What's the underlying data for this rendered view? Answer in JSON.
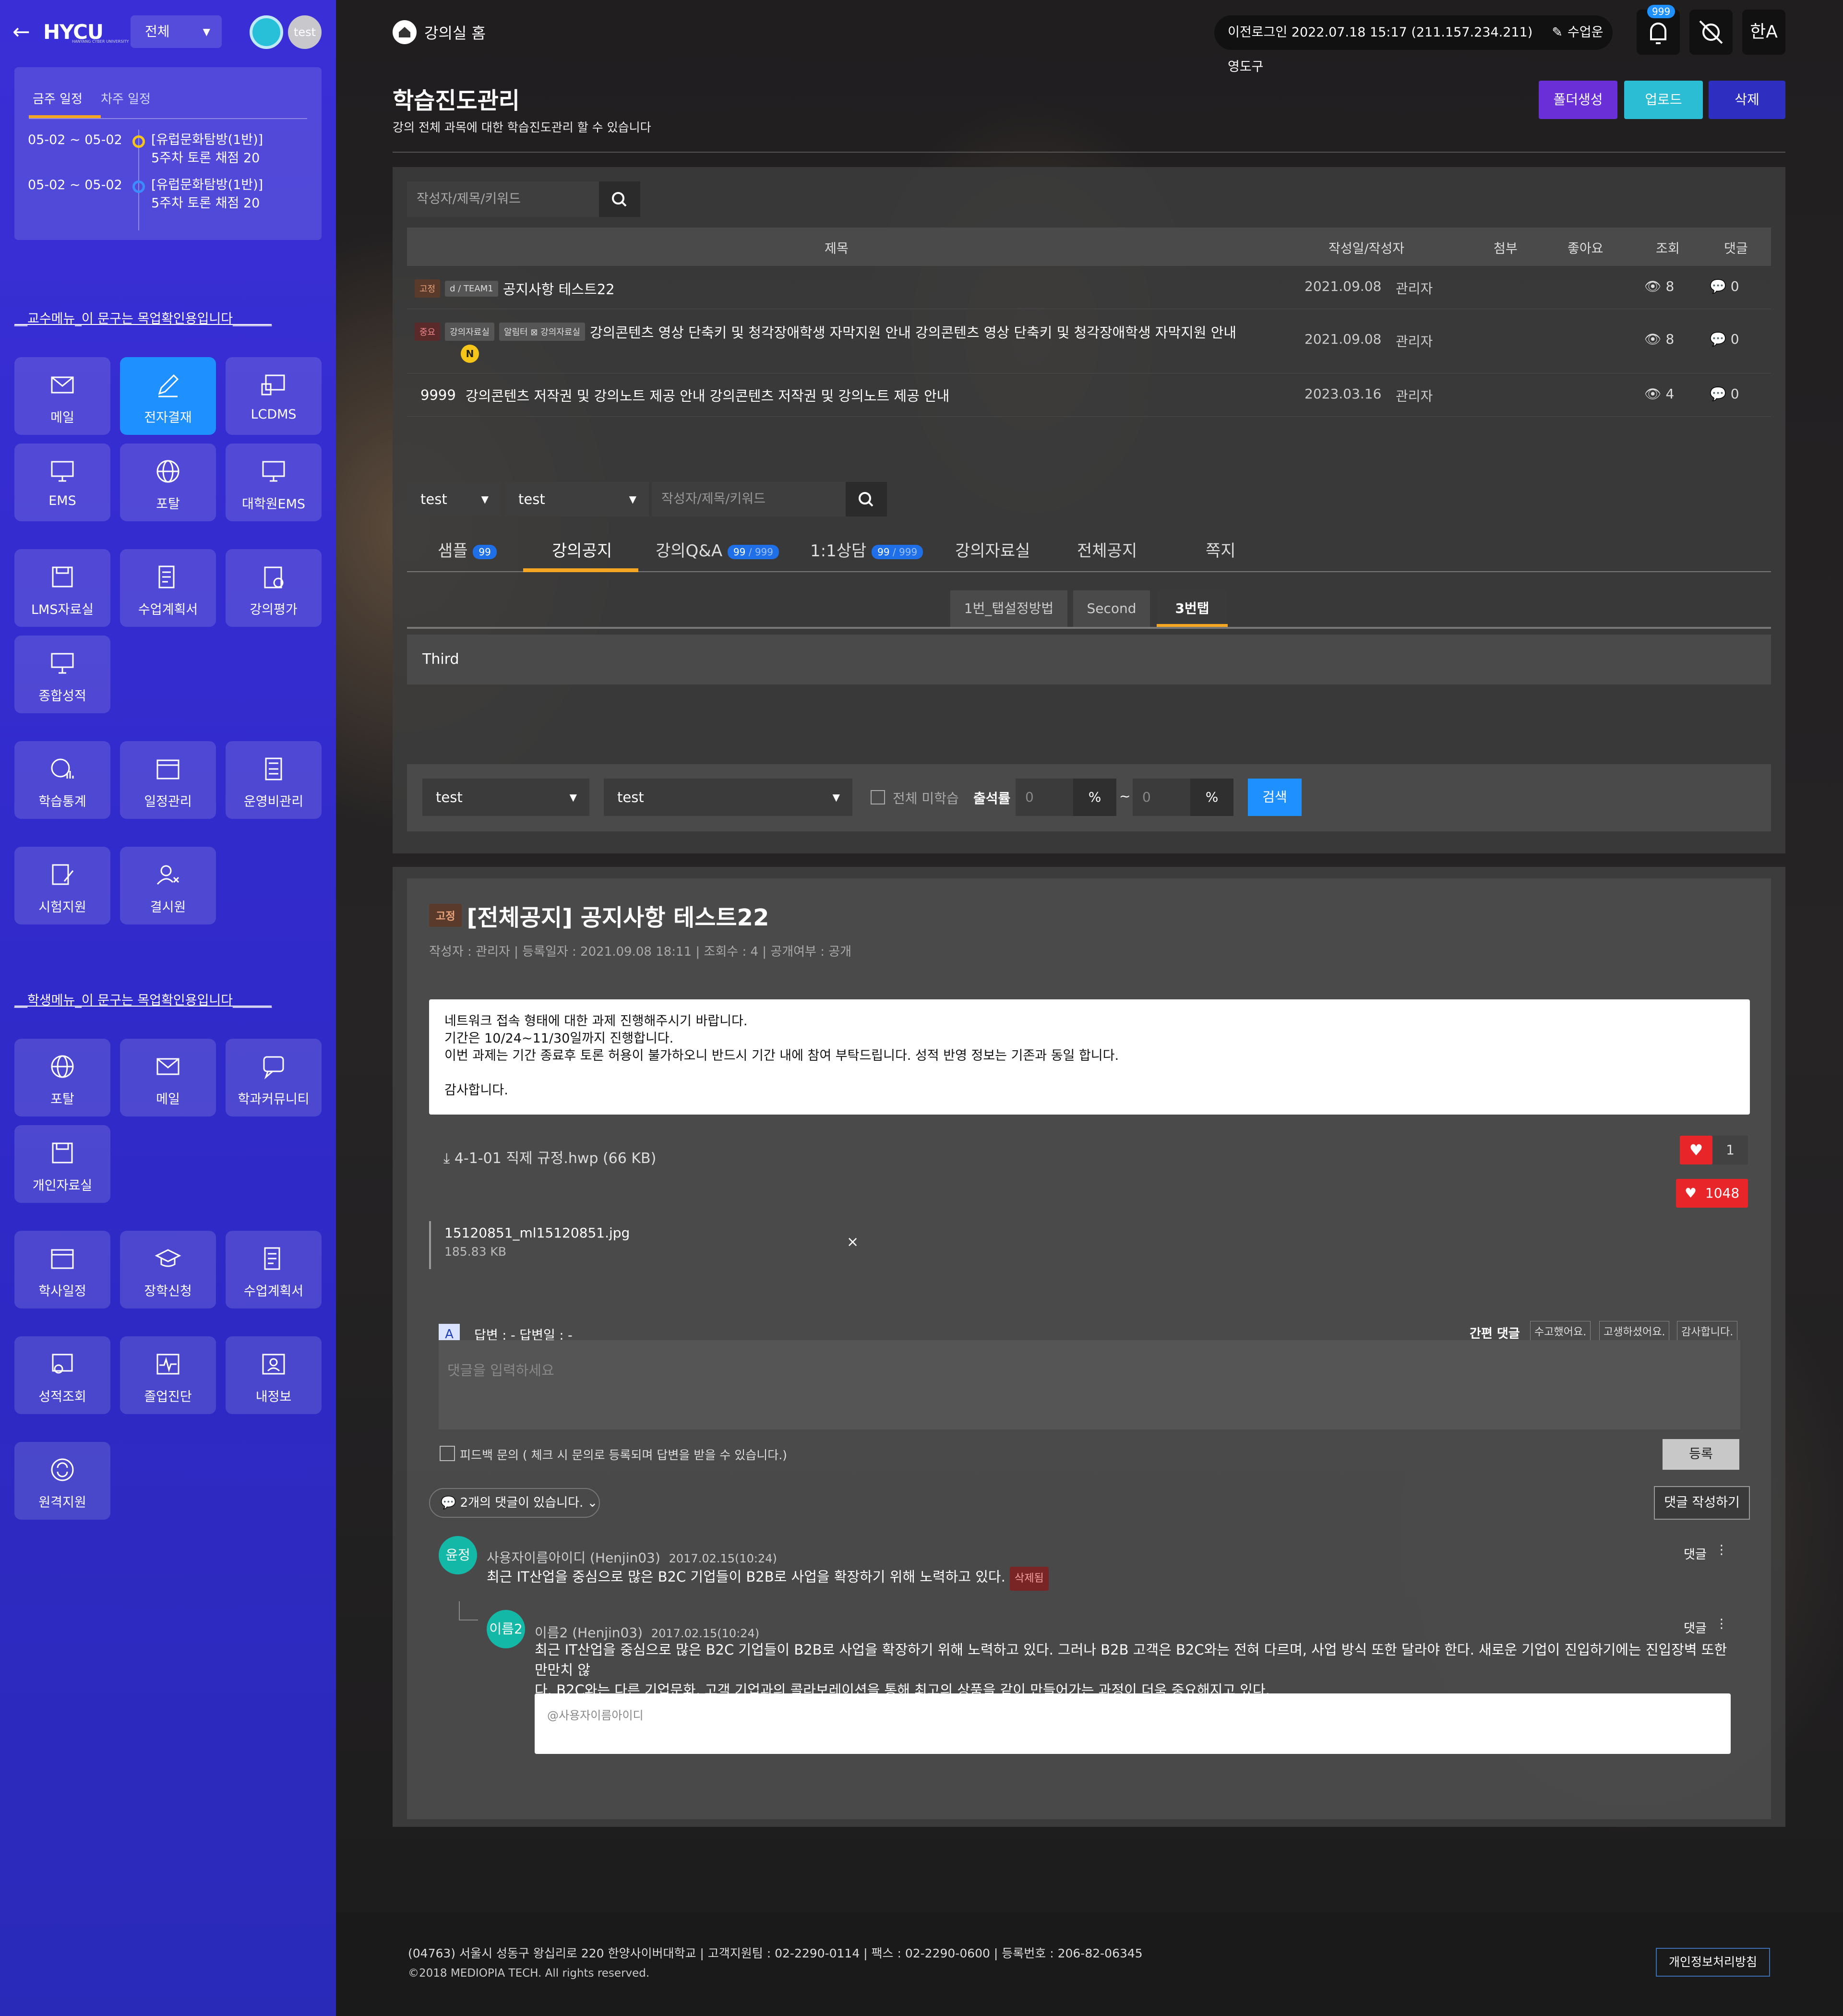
{
  "colors": {
    "sidebar": "#3a2fd6",
    "accent_orange": "#f5a623",
    "blue": "#1e90ff",
    "purple": "#6a2fd6",
    "teal": "#2bbdd4",
    "navy": "#2e2ec0"
  },
  "sidebar": {
    "logo": "HYCU",
    "logo_sub": "HANYANG CYBER UNIVERSITY",
    "scope_select": "전체",
    "avatar_text": "test",
    "schedule": {
      "tabs": [
        "금주 일정",
        "차주 일정"
      ],
      "items": [
        {
          "date": "05-02 ~ 05-02",
          "title": "[유럽문화탐방(1반)]",
          "detail": "5주차 토론 채점 20"
        },
        {
          "date": "05-02 ~ 05-02",
          "title": "[유럽문화탐방(1반)]",
          "detail": "5주차 토론 채점 20"
        }
      ]
    },
    "prof_menu_title": "__교수메뉴_이 문구는 목업확인용입니다______",
    "prof_tiles": [
      "메일",
      "전자결재",
      "LCDMS",
      "EMS",
      "포탈",
      "대학원EMS",
      "LMS자료실",
      "수업계획서",
      "강의평가",
      "종합성적",
      "학습통계",
      "일정관리",
      "운영비관리",
      "시험지원",
      "결시원"
    ],
    "student_menu_title": "__학생메뉴_이 문구는 목업확인용입니다______",
    "student_tiles": [
      "포탈",
      "메일",
      "학과커뮤니티",
      "개인자료실",
      "학사일정",
      "장학신청",
      "수업계획서",
      "성적조회",
      "졸업진단",
      "내정보",
      "원격지원"
    ]
  },
  "header": {
    "breadcrumb": "강의실 홈",
    "last_login": "이전로그인 2022.07.18 15:17 (211.157.234.211)",
    "tool_label": "수업운영도구",
    "bell_badge": "999",
    "lang": "한A"
  },
  "page": {
    "title": "학습진도관리",
    "subtitle": "강의 전체 과목에 대한 학습진도관리 할 수 있습니다",
    "btn_folder": "폴더생성",
    "btn_upload": "업로드",
    "btn_delete": "삭제"
  },
  "board": {
    "search_placeholder": "작성자/제목/키워드",
    "columns": {
      "title": "제목",
      "date_author": "작성일/작성자",
      "attach": "첨부",
      "like": "좋아요",
      "views": "조회",
      "comments": "댓글"
    },
    "rows": [
      {
        "tags": [
          "고정",
          "d / TEAM1"
        ],
        "title": "공지사항 테스트22",
        "date": "2021.09.08",
        "author": "관리자",
        "views": "8",
        "comments": "0"
      },
      {
        "tags": [
          "중요",
          "강의자료실",
          "알림터 ⊠ 강의자료실"
        ],
        "title": "강의콘텐츠 영상 단축키 및 청각장애학생 자막지원 안내 강의콘텐츠 영상 단축키 및 청각장애학생 자막지원 안내",
        "new_badge": "N",
        "date": "2021.09.08",
        "author": "관리자",
        "views": "8",
        "comments": "0"
      },
      {
        "tags": [],
        "prefix": "9999",
        "title": "강의콘텐츠 저작권 및 강의노트 제공 안내 강의콘텐츠 저작권 및 강의노트 제공 안내",
        "date": "2023.03.16",
        "author": "관리자",
        "views": "4",
        "comments": "0"
      }
    ]
  },
  "filters": {
    "select1": "test",
    "select2": "test",
    "search_placeholder": "작성자/제목/키워드",
    "main_tabs": [
      {
        "label": "샘플",
        "count": "99"
      },
      {
        "label": "강의공지"
      },
      {
        "label": "강의Q&A",
        "count": "99",
        "total": "/ 999"
      },
      {
        "label": "1:1상담",
        "count": "99",
        "total": "/ 999"
      },
      {
        "label": "강의자료실"
      },
      {
        "label": "전체공지"
      },
      {
        "label": "쪽지"
      }
    ],
    "sub_tabs": [
      "1번_탭설정방법",
      "Second",
      "3번탭"
    ],
    "sub_content": "Third",
    "bar": {
      "select1": "test",
      "select2": "test",
      "checkbox_label": "전체 미학습",
      "rate_label": "출석률",
      "from": "0",
      "to": "0",
      "pct": "%",
      "tilde": "~",
      "search": "검색"
    }
  },
  "post": {
    "tag": "고정",
    "title": "[전체공지] 공지사항 테스트22",
    "meta": "작성자 : 관리자   |   등록일자 : 2021.09.08 18:11   |   조회수 : 4   |   공개여부 : 공개",
    "body": [
      "네트워크 접속 형태에 대한 과제 진행해주시기 바랍니다.",
      "기간은 10/24~11/30일까지 진행합니다.",
      "이번 과제는 기간 종료후 토론 허용이 불가하오니 반드시 기간 내에 참여 부탁드립니다. 성적 반영 정보는 기존과 동일 합니다.",
      "",
      "감사합니다."
    ],
    "attachment": "4-1-01 직제 규정.hwp (66 KB)",
    "like1": "1",
    "like2": "1048",
    "file_name": "15120851_ml15120851.jpg",
    "file_size": "185.83 KB",
    "answer_badge": "A",
    "answer_label": "답변 : -  답변일 : -",
    "quick_label": "간편 댓글",
    "quick": [
      "수고했어요.",
      "고생하셨어요.",
      "감사합니다."
    ],
    "comment_placeholder": "댓글을 입력하세요",
    "feedback": "피드백 문의 ( 체크 시 문의로 등록되며 답변을 받을 수 있습니다.)",
    "register": "등록",
    "comment_count": "2개의 댓글이 있습니다.",
    "write_comment": "댓글 작성하기"
  },
  "comments": [
    {
      "avatar": "윤정",
      "name": "사용자이름아이디 (Henjin03)",
      "date": "2017.02.15(10:24)",
      "text": "최근 IT산업을 중심으로 많은 B2C 기업들이 B2B로 사업을 확장하기 위해 노력하고 있다.",
      "deleted": "삭제됨",
      "reply": "댓글"
    },
    {
      "avatar": "이름2",
      "name": "이름2 (Henjin03)",
      "date": "2017.02.15(10:24)",
      "text1": "최근 IT산업을 중심으로 많은 B2C 기업들이 B2B로 사업을 확장하기 위해 노력하고 있다. 그러나 B2B 고객은 B2C와는 전혀 다르며, 사업 방식 또한 달라야 한다. 새로운 기업이 진입하기에는 진입장벽 또한 만만치 않",
      "text2": "다. B2C와는 다른 기업문화, 고객 기업과의 콜라보레이션을 통해 최고의 상품을 같이 만들어가는 과정이 더욱 중요해지고 있다.",
      "reply": "댓글"
    }
  ],
  "reply_placeholder": "@사용자이름아이디",
  "footer": {
    "address": "(04763) 서울시 성동구 왕십리로 220 한양사이버대학교  |  고객지원팀 : 02-2290-0114  |  팩스 : 02-2290-0600  |  등록번호 : 206-82-06345",
    "copyright": "©2018 MEDIOPIA TECH. All rights reserved.",
    "privacy": "개인정보처리방침"
  }
}
